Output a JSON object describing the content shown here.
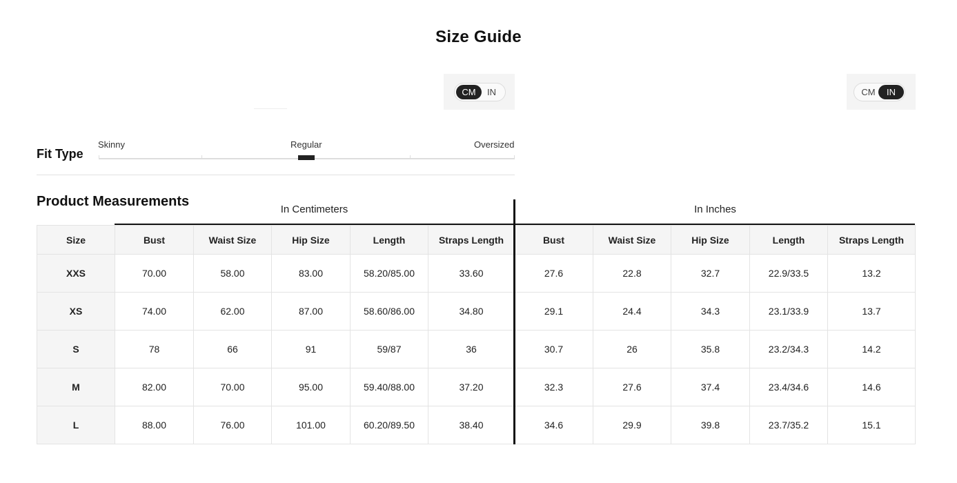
{
  "title": "Size Guide",
  "unit_toggles": [
    {
      "options": [
        "CM",
        "IN"
      ],
      "active": "CM"
    },
    {
      "options": [
        "CM",
        "IN"
      ],
      "active": "IN"
    }
  ],
  "fit_type": {
    "label": "Fit Type",
    "scale": [
      "Skinny",
      "Regular",
      "Oversized"
    ],
    "selected": "Regular"
  },
  "measurements": {
    "title": "Product Measurements",
    "group_cm": "In Centimeters",
    "group_in": "In Inches",
    "size_header": "Size",
    "cm_headers": [
      "Bust",
      "Waist Size",
      "Hip Size",
      "Length",
      "Straps Length"
    ],
    "in_headers": [
      "Bust",
      "Waist Size",
      "Hip Size",
      "Length",
      "Straps Length"
    ],
    "rows": [
      {
        "size": "XXS",
        "cm": [
          "70.00",
          "58.00",
          "83.00",
          "58.20/85.00",
          "33.60"
        ],
        "in": [
          "27.6",
          "22.8",
          "32.7",
          "22.9/33.5",
          "13.2"
        ]
      },
      {
        "size": "XS",
        "cm": [
          "74.00",
          "62.00",
          "87.00",
          "58.60/86.00",
          "34.80"
        ],
        "in": [
          "29.1",
          "24.4",
          "34.3",
          "23.1/33.9",
          "13.7"
        ]
      },
      {
        "size": "S",
        "cm": [
          "78",
          "66",
          "91",
          "59/87",
          "36"
        ],
        "in": [
          "30.7",
          "26",
          "35.8",
          "23.2/34.3",
          "14.2"
        ]
      },
      {
        "size": "M",
        "cm": [
          "82.00",
          "70.00",
          "95.00",
          "59.40/88.00",
          "37.20"
        ],
        "in": [
          "32.3",
          "27.6",
          "37.4",
          "23.4/34.6",
          "14.6"
        ]
      },
      {
        "size": "L",
        "cm": [
          "88.00",
          "76.00",
          "101.00",
          "60.20/89.50",
          "38.40"
        ],
        "in": [
          "34.6",
          "29.9",
          "39.8",
          "23.7/35.2",
          "15.1"
        ]
      }
    ]
  }
}
